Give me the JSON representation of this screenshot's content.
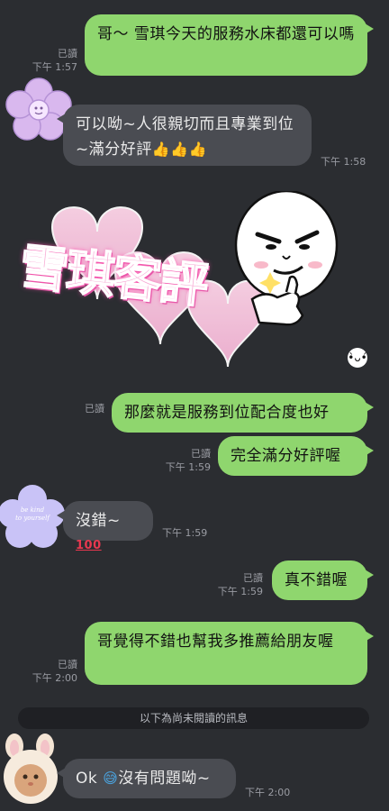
{
  "messages": [
    {
      "id": "m1",
      "text": "哥～ 雪琪今天的服務水床都還可以嗎",
      "read": "已讀",
      "time": "下午 1:57"
    },
    {
      "id": "m2",
      "text": "可以呦~人很親切而且專業到位~滿分好評",
      "time": "下午 1:58"
    },
    {
      "id": "m3",
      "text": "那麼就是服務到位配合度也好",
      "read": "已讀"
    },
    {
      "id": "m4",
      "text": "完全滿分好評喔",
      "read": "已讀",
      "time": "下午 1:59"
    },
    {
      "id": "m5",
      "text": "沒錯~",
      "time": "下午 1:59"
    },
    {
      "id": "m6",
      "text": "真不錯喔",
      "read": "已讀",
      "time": "下午 1:59"
    },
    {
      "id": "m7",
      "text": "哥覺得不錯也幫我多推薦給朋友喔",
      "read": "已讀",
      "time": "下午 2:00"
    },
    {
      "id": "m8",
      "text": "沒有問題呦~",
      "prefix": "Ok",
      "time": "下午 2:00"
    }
  ],
  "sticker": {
    "text": "雪琪客評"
  },
  "avatar_text": {
    "line1": "be kind",
    "line2": "to yourself"
  },
  "divider": {
    "text": "以下為尚未閱讀的訊息"
  },
  "colors": {
    "background": "#2b2d31",
    "out_bubble": "#8fd66e",
    "in_bubble": "#4a4c52"
  }
}
